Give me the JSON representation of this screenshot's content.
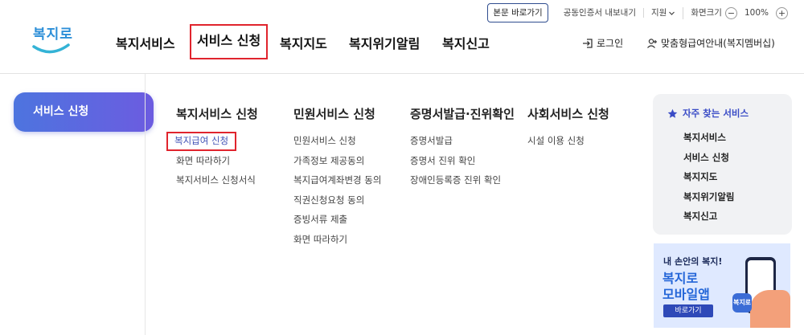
{
  "header": {
    "logo_text": "복지로",
    "skip_link": "본문 바로가기",
    "cert_export": "공동인증서 내보내기",
    "support": "지원",
    "zoom_label": "화면크기",
    "zoom_minus": "−",
    "zoom_value": "100%",
    "zoom_plus": "+",
    "login": "로그인",
    "custom_guide": "맞춤형급여안내(복지멤버십)"
  },
  "gnb": [
    "복지서비스",
    "서비스 신청",
    "복지지도",
    "복지위기알림",
    "복지신고"
  ],
  "side": {
    "active_label": "서비스 신청"
  },
  "columns": [
    {
      "title": "복지서비스 신청",
      "items": [
        "복지급여 신청",
        "화면 따라하기",
        "복지서비스 신청서식"
      ]
    },
    {
      "title": "민원서비스 신청",
      "items": [
        "민원서비스 신청",
        "가족정보 제공동의",
        "복지급여계좌변경 동의",
        "직권신청요청 동의",
        "증빙서류 제출",
        "화면 따라하기"
      ]
    },
    {
      "title": "증명서발급·진위확인",
      "items": [
        "증명서발급",
        "증명서 진위 확인",
        "장애인등록증 진위 확인"
      ]
    },
    {
      "title": "사회서비스 신청",
      "items": [
        "시설 이용 신청"
      ]
    }
  ],
  "favorites": {
    "title": "자주 찾는 서비스",
    "items": [
      "복지서비스",
      "서비스 신청",
      "복지지도",
      "복지위기알림",
      "복지신고"
    ]
  },
  "banner": {
    "subtitle": "내 손안의 복지!",
    "title_line1": "복지로",
    "title_line2": "모바일앱",
    "button": "바로가기",
    "app_icon_text": "복지로"
  },
  "colors": {
    "accent_blue": "#3a4cc6",
    "highlight_red": "#e0242d",
    "side_gradient_start": "#4d74df",
    "side_gradient_end": "#6c5ce0"
  }
}
